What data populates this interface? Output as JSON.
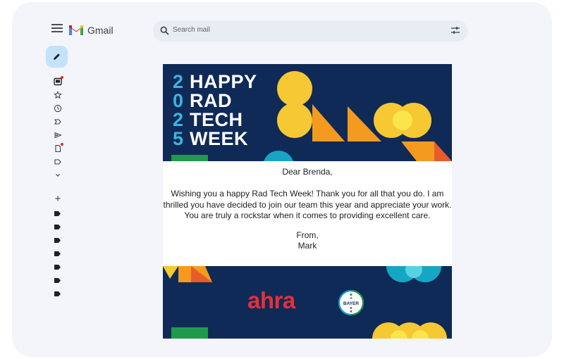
{
  "app": {
    "name": "Gmail"
  },
  "search": {
    "placeholder": "Search mail"
  },
  "sidebar": {
    "nav_icons": [
      "inbox-icon",
      "star-icon",
      "clock-icon",
      "label-important-icon",
      "send-icon",
      "draft-icon",
      "label-icon",
      "chevron-down-icon"
    ],
    "add_label": "+"
  },
  "email": {
    "banner": {
      "year_digits": [
        "2",
        "0",
        "2",
        "5"
      ],
      "title_lines": [
        "HAPPY",
        "RAD",
        "TECH",
        "WEEK"
      ]
    },
    "greeting": "Dear Brenda,",
    "message": "Wishing you a happy Rad Tech Week! Thank you for all that you do. I am thrilled you have decided to join our team this year and appreciate your work. You are truly a rockstar when it comes to providing excellent care.",
    "closing": "From,",
    "signature": "Mark",
    "footer": {
      "logo_text": "ahra",
      "seal_text": [
        "BAYER",
        "B",
        "A",
        "E",
        "R"
      ]
    }
  },
  "colors": {
    "banner_bg": "#0f2a57",
    "accent_yellow": "#f6c834",
    "accent_orange": "#f49a1f",
    "accent_teal": "#16a6c4",
    "accent_green": "#1f9a4a",
    "digit_blue": "#39b5e0",
    "ahra_red": "#e4303b",
    "unread_dot": "#d93025",
    "compose_bg": "#c3e3fb"
  }
}
